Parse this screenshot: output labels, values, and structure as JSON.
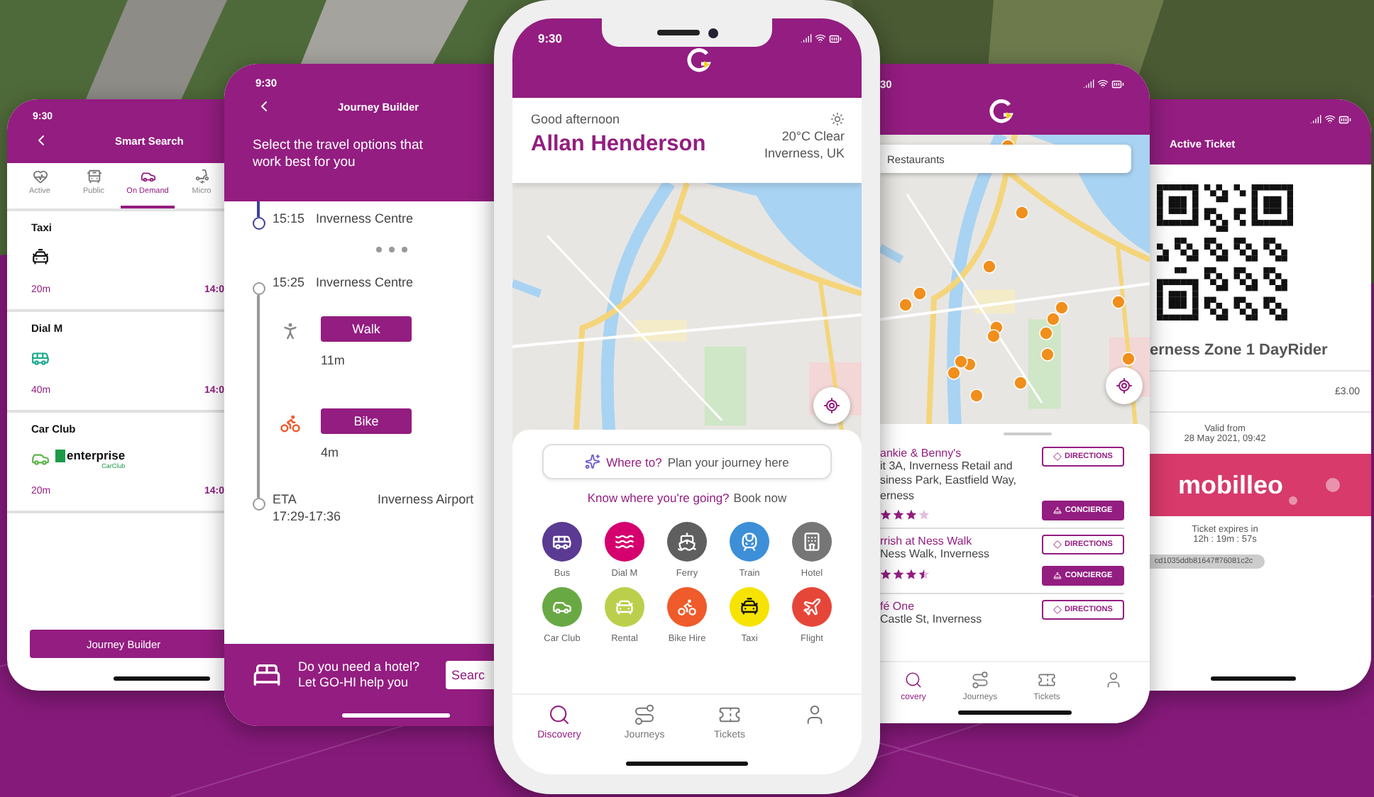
{
  "smart_search": {
    "status_time": "9:30",
    "title": "Smart Search",
    "tabs": [
      {
        "label": "Active",
        "kind": "active",
        "selected": false
      },
      {
        "label": "Public",
        "kind": "public",
        "selected": false
      },
      {
        "label": "On Demand",
        "kind": "on_demand",
        "selected": true
      },
      {
        "label": "Micro",
        "kind": "micro",
        "selected": false
      }
    ],
    "results": [
      {
        "name": "Taxi",
        "kind": "taxi",
        "duration": "20m",
        "time": "14:0"
      },
      {
        "name": "Dial M",
        "kind": "bus",
        "duration": "40m",
        "time": "14:0"
      },
      {
        "name": "Car Club",
        "kind": "car_club",
        "logo_text": "enterprise",
        "logo_subtext": "CarClub",
        "duration": "20m",
        "time": "14:0"
      }
    ],
    "button": "Journey Builder"
  },
  "journey_builder": {
    "status_time": "9:30",
    "title": "Journey Builder",
    "intro": "Select the travel options that work best for you",
    "timeline": [
      {
        "kind": "stop",
        "time": "15:15",
        "place": "Inverness Centre",
        "current": true
      },
      {
        "kind": "more"
      },
      {
        "kind": "stop",
        "time": "15:25",
        "place": "Inverness Centre",
        "current": false
      },
      {
        "kind": "walk",
        "label": "Walk",
        "duration": "11m"
      },
      {
        "kind": "bike",
        "label": "Bike",
        "duration": "4m"
      },
      {
        "kind": "arrival",
        "label": "ETA",
        "time": "17:29-17:36",
        "place": "Inverness Airport"
      }
    ],
    "footer": {
      "lines": [
        "Do you need a hotel?",
        "Let GO-HI help you"
      ],
      "button": "Searc"
    }
  },
  "home": {
    "status_time": "9:30",
    "greeting": "Good afternoon",
    "user_name": "Allan Henderson",
    "weather": "20°C Clear",
    "location": "Inverness, UK",
    "search": {
      "label": "Where to?",
      "placeholder": "Plan your journey here"
    },
    "book": {
      "prompt": "Know where you're going?",
      "link": "Book now"
    },
    "modes": [
      {
        "label": "Bus",
        "kind": "bus",
        "color": "#5a3a92"
      },
      {
        "label": "Dial M",
        "kind": "dial_m",
        "color": "#d5006e"
      },
      {
        "label": "Ferry",
        "kind": "ferry",
        "color": "#5f5f5f"
      },
      {
        "label": "Train",
        "kind": "train",
        "color": "#3d8fd8"
      },
      {
        "label": "Hotel",
        "kind": "hotel",
        "color": "#767676"
      },
      {
        "label": "Car Club",
        "kind": "car_club",
        "color": "#69a944"
      },
      {
        "label": "Rental",
        "kind": "rental",
        "color": "#bccf4c"
      },
      {
        "label": "Bike Hire",
        "kind": "bike",
        "color": "#ef5b2a"
      },
      {
        "label": "Taxi",
        "kind": "taxi",
        "color": "#f6e300"
      },
      {
        "label": "Flight",
        "kind": "flight",
        "color": "#e64638"
      }
    ],
    "nav": [
      {
        "label": "Discovery",
        "kind": "discovery",
        "selected": true
      },
      {
        "label": "Journeys",
        "kind": "journeys",
        "selected": false
      },
      {
        "label": "Tickets",
        "kind": "tickets",
        "selected": false
      },
      {
        "kind": "profile",
        "selected": false
      }
    ]
  },
  "restaurants": {
    "status_time": "30",
    "search": {
      "value": "Restaurants"
    },
    "places": [
      {
        "name": "ankie & Benny's",
        "address": [
          "it 3A, Inverness Retail and",
          "siness Park, Eastfield Way,",
          "erness"
        ],
        "stars": 3,
        "actions": [
          "DIRECTIONS",
          "CONCIERGE"
        ]
      },
      {
        "name": "rrish at Ness Walk",
        "address": [
          "Ness Walk, Inverness"
        ],
        "stars": 3.5,
        "actions": [
          "DIRECTIONS",
          "CONCIERGE"
        ]
      },
      {
        "name": "fé One",
        "address": [
          "Castle St, Inverness"
        ],
        "actions": [
          "DIRECTIONS"
        ]
      }
    ],
    "nav": [
      {
        "label": "covery",
        "kind": "discovery",
        "selected": true
      },
      {
        "label": "Journeys",
        "kind": "journeys",
        "selected": false
      },
      {
        "label": "Tickets",
        "kind": "tickets",
        "selected": false
      },
      {
        "kind": "profile",
        "selected": false
      }
    ]
  },
  "active_ticket": {
    "title": "Active Ticket",
    "ticket_name": "erness Zone 1 DayRider",
    "price": "£3.00",
    "valid_label": "Valid from",
    "valid_date": "28 May 2021, 09:42",
    "brand": "mobilleo",
    "expires_label": "Ticket expires in",
    "countdown": "12h : 19m : 57s",
    "code": "cd1035ddb81647ff76081c2c"
  }
}
